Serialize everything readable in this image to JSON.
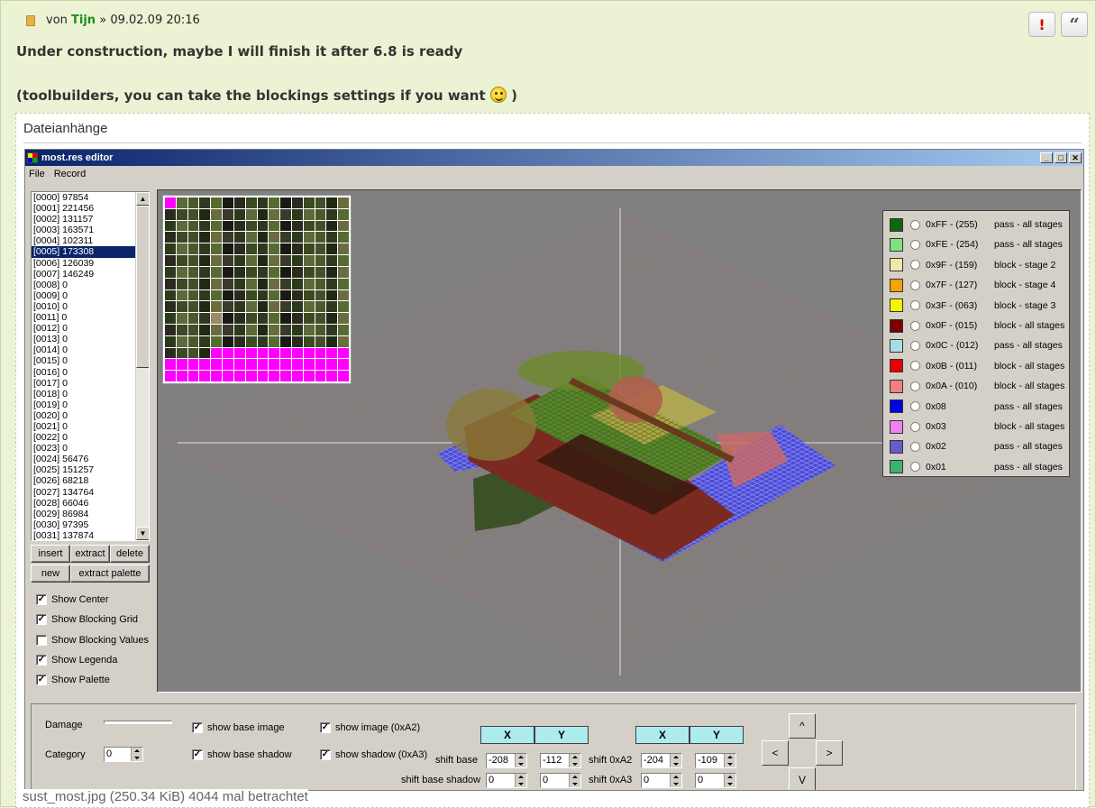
{
  "post": {
    "by_prefix": "von",
    "author": "Tijn",
    "date_sep": "»",
    "datetime": "09.02.09 20:16",
    "report_icon_glyph": "!",
    "quote_icon_glyph": "“",
    "line1": "Under construction, maybe I will finish it after 6.8 is ready",
    "line2_prefix": "(toolbuilders, you can take the blockings settings if you want",
    "line2_suffix": ")"
  },
  "attachments": {
    "title": "Dateianhänge",
    "caption": "sust_most.jpg (250.34 KiB) 4044 mal betrachtet"
  },
  "app": {
    "title": "most.res editor",
    "title_buttons": [
      "_",
      "□",
      "✕"
    ],
    "menu": [
      "File",
      "Record"
    ],
    "records": [
      "[0000] 97854",
      "[0001] 221456",
      "[0002] 131157",
      "[0003] 163571",
      "[0004] 102311",
      "[0005] 173308",
      "[0006] 126039",
      "[0007] 146249",
      "[0008] 0",
      "[0009] 0",
      "[0010] 0",
      "[0011] 0",
      "[0012] 0",
      "[0013] 0",
      "[0014] 0",
      "[0015] 0",
      "[0016] 0",
      "[0017] 0",
      "[0018] 0",
      "[0019] 0",
      "[0020] 0",
      "[0021] 0",
      "[0022] 0",
      "[0023] 0",
      "[0024] 56476",
      "[0025] 151257",
      "[0026] 68218",
      "[0027] 134764",
      "[0028] 66046",
      "[0029] 86984",
      "[0030] 97395",
      "[0031] 137874"
    ],
    "selected_record": "[0005] 173308",
    "buttons": {
      "insert": "insert",
      "extract": "extract",
      "delete": "delete",
      "new": "new",
      "extract_palette": "extract palette"
    },
    "checkboxes": [
      {
        "label": "Show Center",
        "checked": true
      },
      {
        "label": "Show Blocking Grid",
        "checked": true
      },
      {
        "label": "Show Blocking Values",
        "checked": false
      },
      {
        "label": "Show Legenda",
        "checked": true
      },
      {
        "label": "Show Palette",
        "checked": true
      }
    ],
    "legend": [
      {
        "color": "#0B6B0B",
        "code": "0xFF - (255)",
        "desc": "pass - all stages"
      },
      {
        "color": "#7FE07F",
        "code": "0xFE - (254)",
        "desc": "pass - all stages"
      },
      {
        "color": "#F2E6A8",
        "code": "0x9F - (159)",
        "desc": "block - stage 2"
      },
      {
        "color": "#F5A300",
        "code": "0x7F - (127)",
        "desc": "block - stage 4"
      },
      {
        "color": "#F5F500",
        "code": "0x3F - (063)",
        "desc": "block - stage 3"
      },
      {
        "color": "#7A0000",
        "code": "0x0F - (015)",
        "desc": "block - all stages"
      },
      {
        "color": "#A9DDE6",
        "code": "0x0C - (012)",
        "desc": "pass - all stages"
      },
      {
        "color": "#E80000",
        "code": "0x0B - (011)",
        "desc": "block - all stages"
      },
      {
        "color": "#F08080",
        "code": "0x0A - (010)",
        "desc": "block - all stages"
      },
      {
        "color": "#0000E0",
        "code": "0x08",
        "desc": "pass - all stages"
      },
      {
        "color": "#EE82EE",
        "code": "0x03",
        "desc": "block - all stages"
      },
      {
        "color": "#6A5ACD",
        "code": "0x02",
        "desc": "pass - all stages"
      },
      {
        "color": "#3CB371",
        "code": "0x01",
        "desc": "pass - all stages"
      }
    ],
    "controls": {
      "damage_label": "Damage",
      "category_label": "Category",
      "category_value": "0",
      "show_base_image": "show base image",
      "show_base_shadow": "show base shadow",
      "show_image": "show image (0xA2)",
      "show_shadow": "show shadow (0xA3)",
      "x_label": "X",
      "y_label": "Y",
      "shift_base": "shift base",
      "shift_base_shadow": "shift base shadow",
      "shift_a2": "shift 0xA2",
      "shift_a3": "shift 0xA3",
      "shift_base_x": "-208",
      "shift_base_y": "-112",
      "shift_base_shadow_x": "0",
      "shift_base_shadow_y": "0",
      "shift_a2_x": "-204",
      "shift_a2_y": "-109",
      "shift_a3_x": "0",
      "shift_a3_y": "0",
      "arrow_up": "^",
      "arrow_left": "<",
      "arrow_right": ">",
      "arrow_down": "V"
    }
  }
}
